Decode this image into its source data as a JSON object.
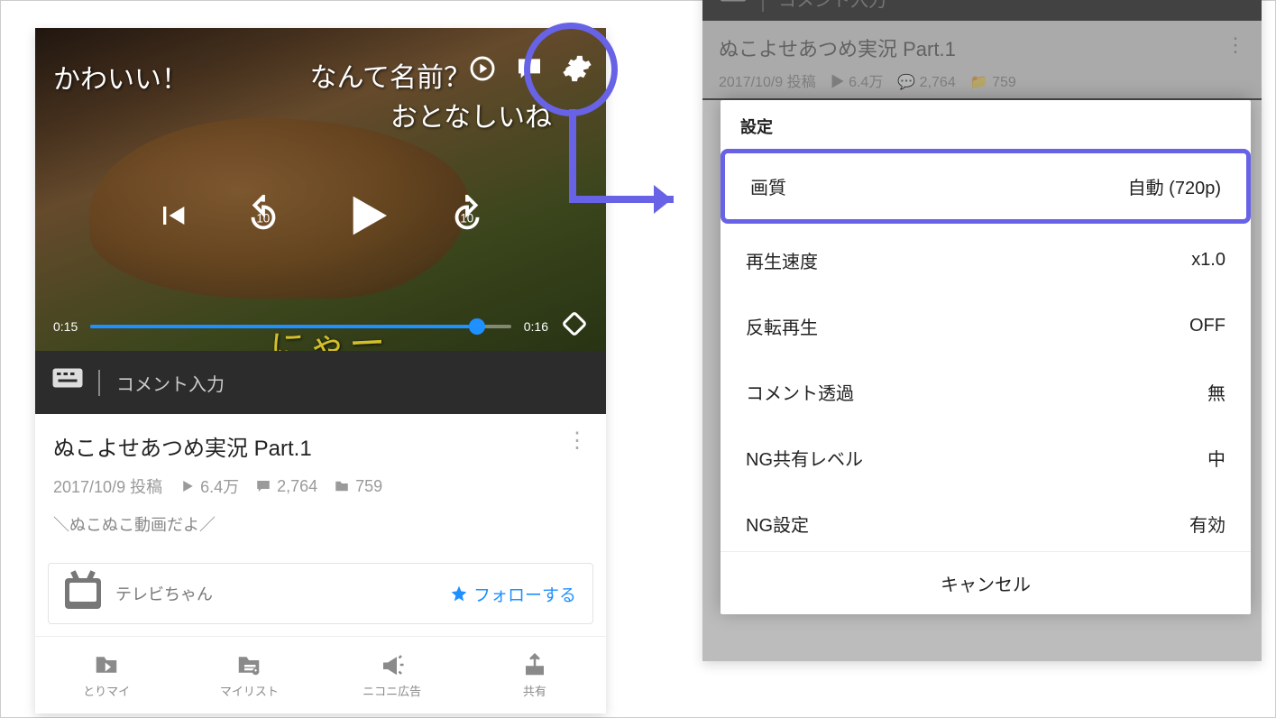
{
  "left": {
    "overlay_comments": {
      "t1": "かわいい！",
      "t2": "なんて名前？",
      "t3": "おとなしいね",
      "t4": "にゃー"
    },
    "progress": {
      "current": "0:15",
      "total": "0:16"
    },
    "comment_placeholder": "コメント入力",
    "title": "ぬこよせあつめ実況 Part.1",
    "meta": {
      "date": "2017/10/9 投稿",
      "views": "6.4万",
      "comments": "2,764",
      "mylists": "759"
    },
    "description": "＼ぬこぬこ動画だよ／",
    "uploader": {
      "name": "テレビちゃん",
      "follow_label": "フォローする"
    },
    "tabs": [
      {
        "label": "とりマイ"
      },
      {
        "label": "マイリスト"
      },
      {
        "label": "ニコニ広告"
      },
      {
        "label": "共有"
      }
    ]
  },
  "right": {
    "dim_comment_placeholder": "コメント入力",
    "dim_title": "ぬこよせあつめ実況 Part.1",
    "dim_meta": "2017/10/9 投稿　▶ 6.4万　💬 2,764　📁 759",
    "sheet_title": "設定",
    "rows": [
      {
        "label": "画質",
        "value": "自動 (720p)"
      },
      {
        "label": "再生速度",
        "value": "x1.0"
      },
      {
        "label": "反転再生",
        "value": "OFF"
      },
      {
        "label": "コメント透過",
        "value": "無"
      },
      {
        "label": "NG共有レベル",
        "value": "中"
      },
      {
        "label": "NG設定",
        "value": "有効"
      }
    ],
    "cancel": "キャンセル"
  }
}
